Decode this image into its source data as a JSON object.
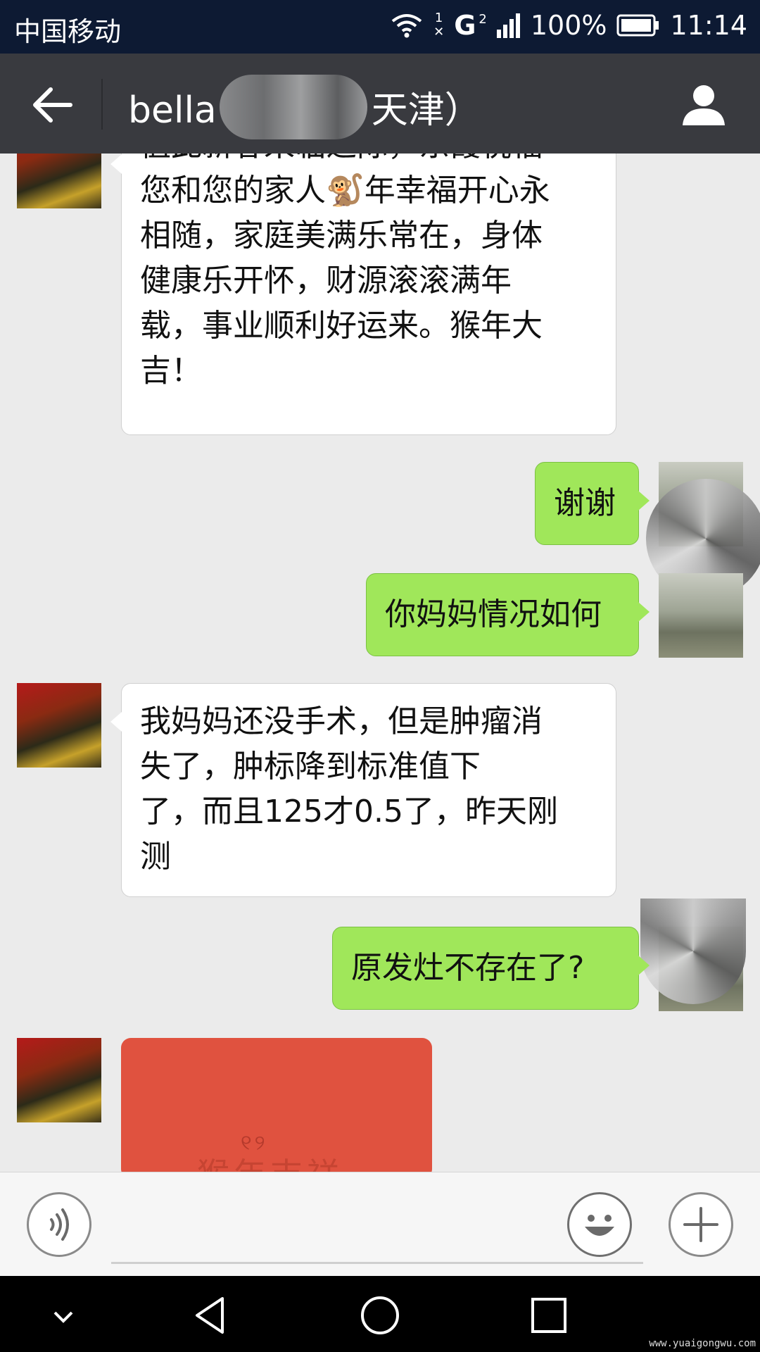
{
  "status_bar": {
    "carrier": "中国移动",
    "sim1": "1",
    "network": "G",
    "sim2": "2",
    "battery": "100%",
    "time": "11:14"
  },
  "header": {
    "title_left": "bella",
    "title_right": "天津）"
  },
  "messages": [
    {
      "side": "in",
      "text": "值此新春来临之际，东霞祝福\n您和您的家人🐒年幸福开心永\n相随，家庭美满乐常在，身体\n健康乐开怀，财源滚滚满年\n载，事业顺利好运来。猴年大\n吉！"
    },
    {
      "side": "out",
      "text": "谢谢"
    },
    {
      "side": "out",
      "text": "你妈妈情况如何"
    },
    {
      "side": "in",
      "text": "我妈妈还没手术，但是肿瘤消\n失了，肿标降到标准值下\n了，而且125才0.5了，昨天刚\n测"
    },
    {
      "side": "out",
      "text": "原发灶不存在了?"
    }
  ],
  "red_packet": {
    "deco": "୧୨",
    "label": "猴年吉祥"
  },
  "input": {
    "placeholder": ""
  },
  "watermark": "www.yuaigongwu.com",
  "colors": {
    "status_bar": "#0d1a33",
    "header": "#393a3f",
    "chat_bg": "#ebebeb",
    "outgoing_bubble": "#a0e75a",
    "incoming_bubble": "#ffffff",
    "red_packet": "#e0523f"
  },
  "icons": {
    "back": "arrow-left-icon",
    "contact": "person-icon",
    "voice": "voice-icon",
    "emoji": "smiley-icon",
    "plus": "plus-icon",
    "nav_hide": "chevron-down-icon",
    "nav_back": "triangle-back-icon",
    "nav_home": "circle-home-icon",
    "nav_recent": "square-recent-icon"
  }
}
